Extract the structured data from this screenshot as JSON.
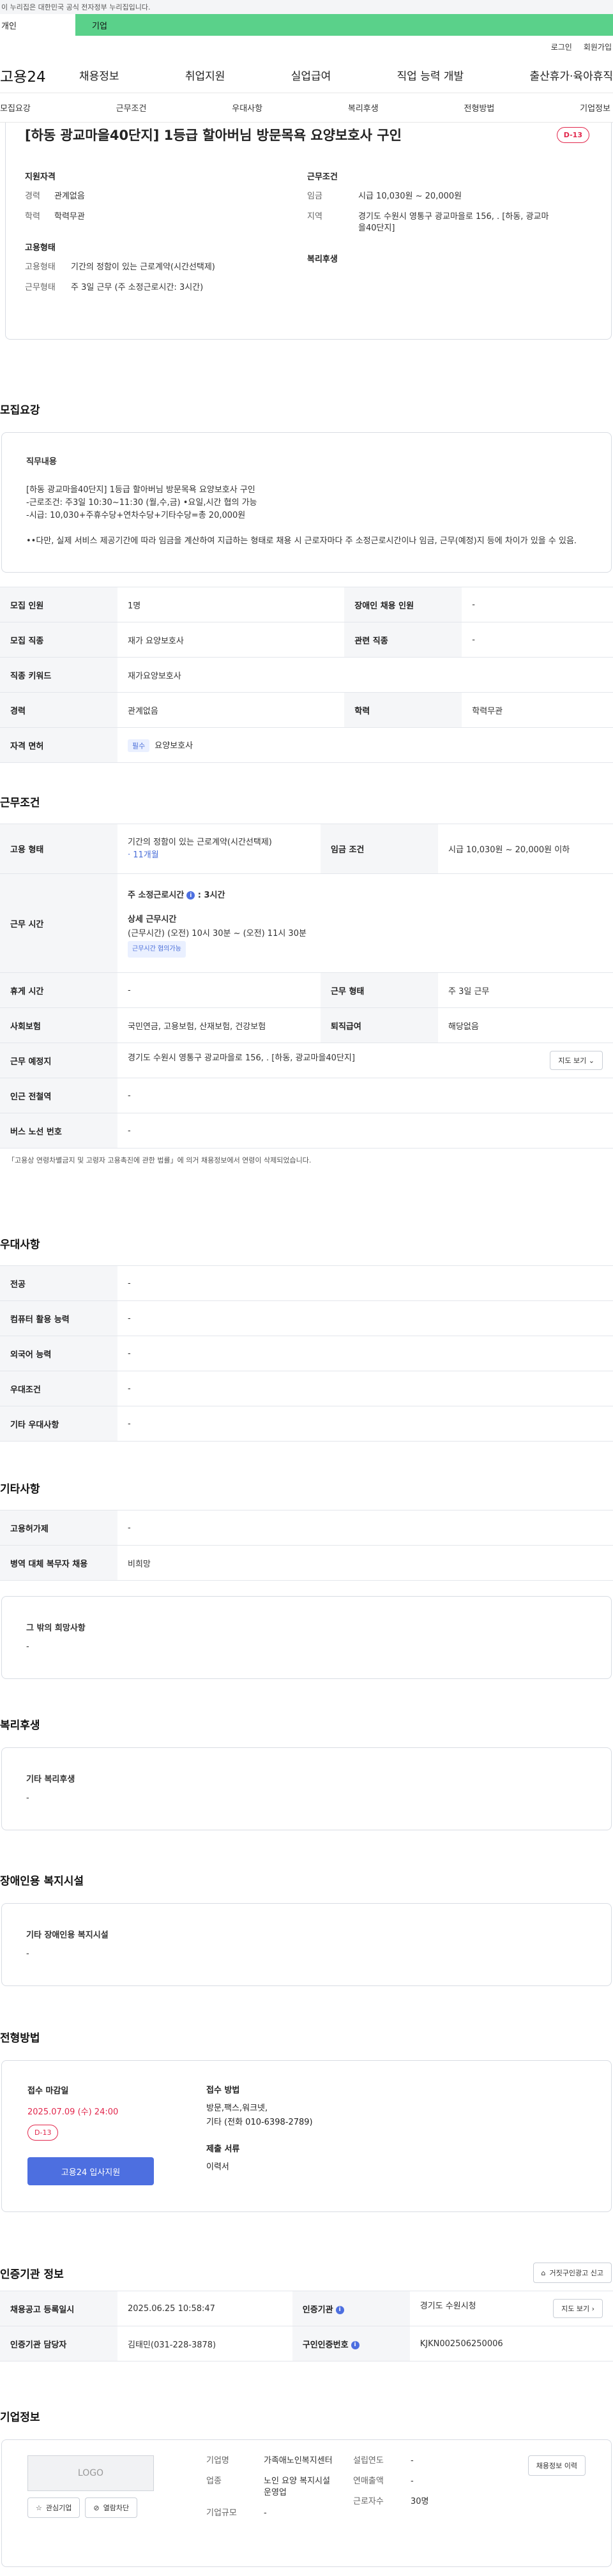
{
  "topbar": {
    "notice": "이 누리집은 대한민국 공식 전자정부 누리집입니다."
  },
  "tabs": {
    "personal": "개인",
    "company": "기업"
  },
  "util": {
    "login": "로그인",
    "signup": "회원가입"
  },
  "gnb": {
    "logo": "고용24",
    "items": [
      "채용정보",
      "취업지원",
      "실업급여",
      "직업 능력 개발",
      "출산휴가·육아휴직"
    ]
  },
  "subnav": [
    "모집요강",
    "근무조건",
    "우대사항",
    "복리후생",
    "전형방법",
    "기업정보"
  ],
  "summary": {
    "title": "[하동 광교마을40단지] 1등급 할아버님 방문목욕 요양보호사 구인",
    "dday": "D-13",
    "qual_h": "지원자격",
    "career_k": "경력",
    "career_v": "관계없음",
    "edu_k": "학력",
    "edu_v": "학력무관",
    "cond_h": "근무조건",
    "wage_k": "임금",
    "wage_v": "시급 10,030원 ~ 20,000원",
    "region_k": "지역",
    "region_v": "경기도 수원시 영통구 광교마을로 156, . [하동, 광교마을40단지]",
    "emp_h": "고용형태",
    "etype_k": "고용형태",
    "etype_v": "기간의 정함이 있는 근로계약(시간선택제)",
    "wtype_k": "근무형태",
    "wtype_v": "주 3일 근무 (주 소정근로시간: 3시간)",
    "welfare_h": "복리후생"
  },
  "recruit": {
    "title": "모집요강",
    "desc_h": "직무내용",
    "desc_lines": [
      "[하동 광교마을40단지] 1등급 할아버님 방문목욕 요양보호사 구인",
      "-근로조건: 주3일 10:30~11:30 (월,수,금) •요일,시간 협의 가능",
      "-시급: 10,030+주휴수당+연차수당+기타수당=총 20,000원",
      "",
      "••다만, 실제 서비스 제공기간에 따라 임금을 계산하여 지급하는 형태로 채용 시 근로자마다 주 소정근로시간이나 임금, 근무(예정)지 등에 차이가 있을 수 있음."
    ],
    "rows": {
      "headcount_k": "모집 인원",
      "headcount_v": "1명",
      "disabled_k": "장애인 채용 인원",
      "disabled_v": "-",
      "job_k": "모집 직종",
      "job_v": "재가 요양보호사",
      "related_k": "관련 직종",
      "related_v": "-",
      "keyword_k": "직종 키워드",
      "keyword_v": "재가요양보호사",
      "career_k": "경력",
      "career_v": "관계없음",
      "edu_k": "학력",
      "edu_v": "학력무관",
      "license_k": "자격 면허",
      "license_tag": "필수",
      "license_v": "요양보호사"
    }
  },
  "work": {
    "title": "근무조건",
    "etype_k": "고용 형태",
    "etype_v": "기간의 정함이 있는 근로계약(시간선택제)",
    "etype_period": "· 11개월",
    "wage_k": "임금 조건",
    "wage_v": "시급 10,030원 ~ 20,000원 이하",
    "time_k": "근무 시간",
    "weekly_h": "주 소정근로시간",
    "weekly_v": ": 3시간",
    "detail_h": "상세 근무시간",
    "detail_v": "(근무시간) (오전) 10시 30분 ~ (오전) 11시 30분",
    "detail_tag": "근무시간 협의가능",
    "rest_k": "휴게 시간",
    "rest_v": "-",
    "form_k": "근무 형태",
    "form_v": "주 3일 근무",
    "insurance_k": "사회보험",
    "insurance_v": "국민연금, 고용보험, 산재보험, 건강보험",
    "severance_k": "퇴직급여",
    "severance_v": "해당없음",
    "place_k": "근무 예정지",
    "place_v": "경기도 수원시 영통구 광교마을로 156, . [하동, 광교마을40단지]",
    "map_btn": "지도 보기",
    "station_k": "인근 전철역",
    "station_v": "-",
    "bus_k": "버스 노선 번호",
    "bus_v": "-",
    "note": "「고용상 연령차별금지 및 고령자 고용촉진에 관한 법률」에 의거 채용정보에서 연령이 삭제되었습니다."
  },
  "pref": {
    "title": "우대사항",
    "rows": [
      [
        "전공",
        "-"
      ],
      [
        "컴퓨터 활용 능력",
        "-"
      ],
      [
        "외국어 능력",
        "-"
      ],
      [
        "우대조건",
        "-"
      ],
      [
        "기타 우대사항",
        "-"
      ]
    ]
  },
  "etc": {
    "title": "기타사항",
    "rows": [
      [
        "고용허가제",
        "-"
      ],
      [
        "병역 대체 복무자 채용",
        "비희망"
      ]
    ],
    "box_h": "그 밖의 희망사항",
    "box_v": "-"
  },
  "welfare": {
    "title": "복리후생",
    "box_h": "기타 복리후생",
    "box_v": "-"
  },
  "disability": {
    "title": "장애인용 복지시설",
    "box_h": "기타 장애인용 복지시설",
    "box_v": "-"
  },
  "selection": {
    "title": "전형방법",
    "deadline_h": "접수 마감일",
    "deadline_v": "2025.07.09 (수) 24:00",
    "dday": "D-13",
    "apply_btn": "고용24 입사지원",
    "method_h": "접수 방법",
    "method_v1": "방문,팩스,워크넷,",
    "method_v2": "기타 (전화 010-6398-2789)",
    "docs_h": "제출 서류",
    "docs_v": "이력서"
  },
  "auth": {
    "title": "인증기관 정보",
    "report_btn": "거짓구인광고 신고",
    "reg_k": "채용공고 등록일시",
    "reg_v": "2025.06.25 10:58:47",
    "org_k": "인증기관",
    "org_v": "경기도 수원시청",
    "map_btn": "지도 보기",
    "manager_k": "인증기관 담당자",
    "manager_v": "김태민(031-228-3878)",
    "num_k": "구인인증번호",
    "num_v": "KJKN002506250006"
  },
  "company": {
    "title": "기업정보",
    "logo_text": "LOGO",
    "fav_btn": "관심기업",
    "block_btn": "열람차단",
    "name_k": "기업명",
    "name_v": "가족애노인복지센터",
    "industry_k": "업종",
    "industry_v": "노인 요양 복지시설 운영업",
    "size_k": "기업규모",
    "size_v": "-",
    "founded_k": "설립연도",
    "founded_v": "-",
    "revenue_k": "연매출액",
    "revenue_v": "-",
    "staff_k": "근로자수",
    "staff_v": "30명",
    "more_btn": "채용정보 이력"
  }
}
